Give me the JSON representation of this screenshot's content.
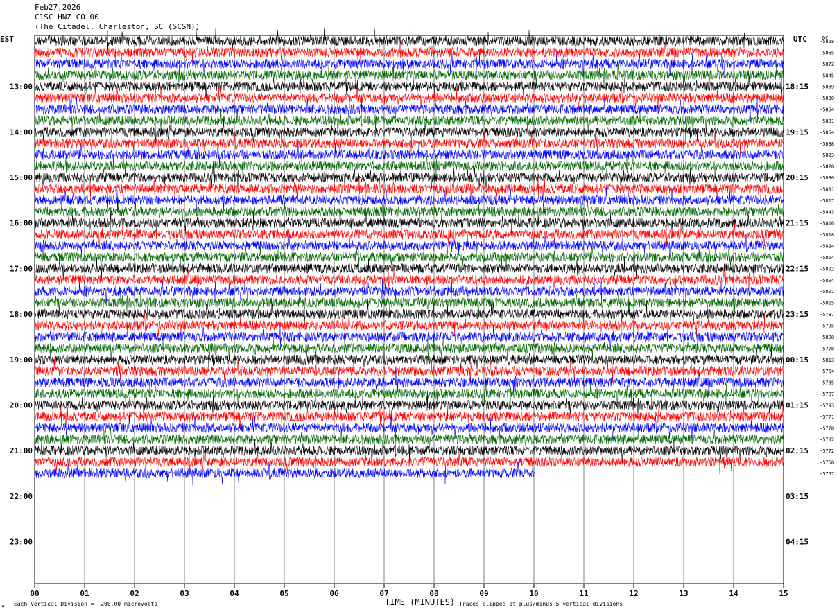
{
  "header": {
    "date": "Feb27,2026",
    "station": "C1SC HNZ CO 00",
    "location": "(The Citadel, Charleston, SC (SCSN))"
  },
  "left_tz_label": "EST",
  "right_tz_label": "UTC",
  "dc_label": "DC",
  "left_hour_labels": [
    "13:00",
    "14:00",
    "15:00",
    "16:00",
    "17:00",
    "18:00",
    "19:00",
    "20:00",
    "21:00",
    "22:00",
    "23:00"
  ],
  "right_hour_labels": [
    "18:15",
    "19:15",
    "20:15",
    "21:15",
    "22:15",
    "23:15",
    "00:15",
    "01:15",
    "02:15",
    "03:15",
    "04:15"
  ],
  "footer": {
    "scale": "Each Vertical Division =  200.00 microvolts",
    "clip": "Traces clipped at plus/minus 5 vertical divisions",
    "corner_mark": "¤"
  },
  "colors": {
    "trace_cycle": [
      "#000000",
      "#ff0000",
      "#0000ff",
      "#006600"
    ],
    "grid": "#808080"
  },
  "chart_data": {
    "type": "line",
    "title": "C1SC HNZ CO 00",
    "xlabel": "TIME (MINUTES)",
    "ylabel": "",
    "x_ticks": [
      "00",
      "01",
      "02",
      "03",
      "04",
      "05",
      "06",
      "07",
      "08",
      "09",
      "10",
      "11",
      "12",
      "13",
      "14",
      "15"
    ],
    "xlim": [
      0,
      15
    ],
    "trace_minutes": 15,
    "traces_per_hour": 4,
    "grid": "vertical minute lines",
    "dc_offsets": [
      -5868,
      -5855,
      -5872,
      -5845,
      -5869,
      -5830,
      -5854,
      -5831,
      -5854,
      -5838,
      -5823,
      -5828,
      -5830,
      -5831,
      -5817,
      -5843,
      -5816,
      -5818,
      -5824,
      -5814,
      -5802,
      -5804,
      -5801,
      -5815,
      -5787,
      -5795,
      -5808,
      -5778,
      -5813,
      -5764,
      -5785,
      -5787,
      -5793,
      -5771,
      -5778,
      -5782,
      -5772,
      -5768,
      -5757
    ],
    "last_trace_end_minute": 10,
    "series": [
      {
        "color": "black"
      },
      {
        "color": "red"
      },
      {
        "color": "blue"
      },
      {
        "color": "green"
      }
    ]
  }
}
